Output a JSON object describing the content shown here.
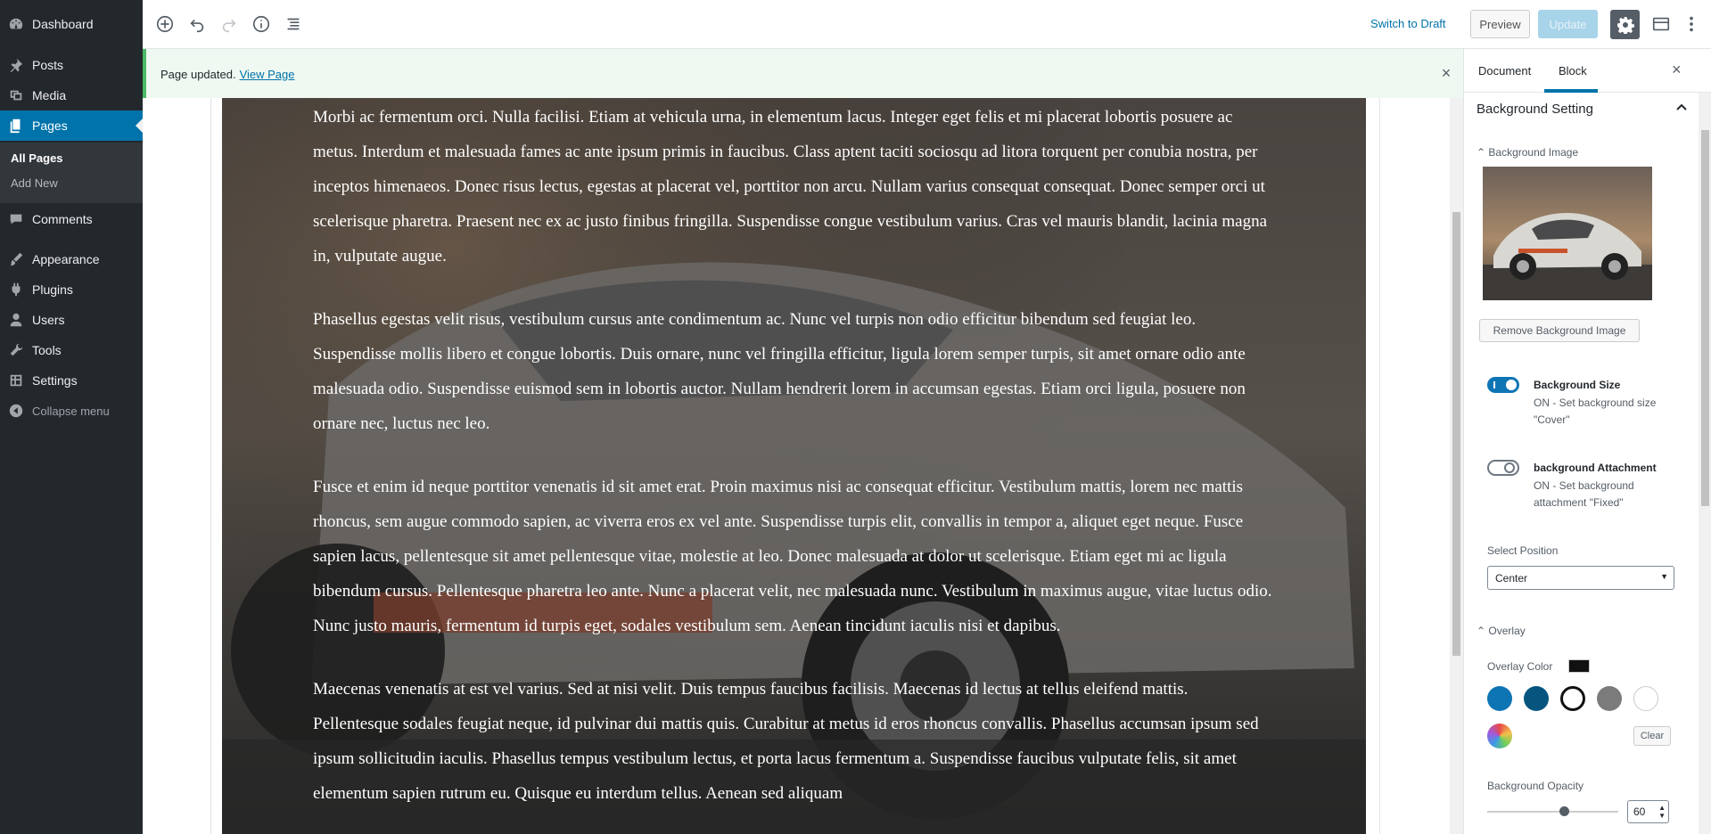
{
  "admin_menu": {
    "items": [
      {
        "label": "Dashboard",
        "icon": "dashboard-icon"
      },
      {
        "label": "Posts",
        "icon": "pin-icon"
      },
      {
        "label": "Media",
        "icon": "media-icon"
      },
      {
        "label": "Pages",
        "icon": "pages-icon"
      },
      {
        "label": "Comments",
        "icon": "comments-icon"
      },
      {
        "label": "Appearance",
        "icon": "brush-icon"
      },
      {
        "label": "Plugins",
        "icon": "plugin-icon"
      },
      {
        "label": "Users",
        "icon": "users-icon"
      },
      {
        "label": "Tools",
        "icon": "wrench-icon"
      },
      {
        "label": "Settings",
        "icon": "settings-icon"
      },
      {
        "label": "Collapse menu",
        "icon": "collapse-icon"
      }
    ],
    "submenu": [
      {
        "label": "All Pages"
      },
      {
        "label": "Add New"
      }
    ]
  },
  "toolbar": {
    "switch_to_draft": "Switch to Draft",
    "preview": "Preview",
    "update": "Update"
  },
  "notice": {
    "message": "Page updated.",
    "link": "View Page"
  },
  "content": {
    "paragraphs": [
      "Morbi ac fermentum orci. Nulla facilisi. Etiam at vehicula urna, in elementum lacus. Integer eget felis et mi placerat lobortis posuere ac metus. Interdum et malesuada fames ac ante ipsum primis in faucibus. Class aptent taciti sociosqu ad litora torquent per conubia nostra, per inceptos himenaeos. Donec risus lectus, egestas at placerat vel, porttitor non arcu. Nullam varius consequat consequat. Donec semper orci ut scelerisque pharetra. Praesent nec ex ac justo finibus fringilla. Suspendisse congue vestibulum varius. Cras vel mauris blandit, lacinia magna in, vulputate augue.",
      "Phasellus egestas velit risus, vestibulum cursus ante condimentum ac. Nunc vel turpis non odio efficitur bibendum sed feugiat leo. Suspendisse mollis libero et congue lobortis. Duis ornare, nunc vel fringilla efficitur, ligula lorem semper turpis, sit amet ornare odio ante malesuada odio. Suspendisse euismod sem in lobortis auctor. Nullam hendrerit lorem in accumsan egestas. Etiam orci ligula, posuere non ornare nec, luctus nec leo.",
      "Fusce et enim id neque porttitor venenatis id sit amet erat. Proin maximus nisi ac consequat efficitur. Vestibulum mattis, lorem nec mattis rhoncus, sem augue commodo sapien, ac viverra eros ex vel ante. Suspendisse turpis elit, convallis in tempor a, aliquet eget neque. Fusce sapien lacus, pellentesque sit amet pellentesque vitae, molestie at leo. Donec malesuada at dolor ut scelerisque. Etiam eget mi ac ligula bibendum cursus. Pellentesque pharetra leo ante. Nunc a placerat velit, nec malesuada nunc. Vestibulum in maximus augue, vitae luctus odio. Nunc justo mauris, fermentum id turpis eget, sodales vestibulum sem. Aenean tincidunt iaculis nisi et dapibus.",
      "Maecenas venenatis at est vel varius. Sed at nisi velit. Duis tempus faucibus facilisis. Maecenas id lectus at tellus eleifend mattis. Pellentesque sodales feugiat neque, id pulvinar dui mattis quis. Curabitur at metus id eros rhoncus convallis. Phasellus accumsan ipsum sed ipsum sollicitudin iaculis. Phasellus tempus vestibulum lectus, et porta lacus fermentum a. Suspendisse faucibus vulputate felis, sit amet elementum sapien rutrum eu. Quisque eu interdum tellus. Aenean sed aliquam"
    ]
  },
  "sidebar": {
    "tabs": [
      {
        "label": "Document"
      },
      {
        "label": "Block"
      }
    ],
    "active_tab": "Block",
    "panel_title": "Background Setting",
    "background_image": {
      "title": "Background Image",
      "remove_label": "Remove Background Image"
    },
    "background_size": {
      "label": "Background Size",
      "description": "ON - Set background size \"Cover\"",
      "enabled": true
    },
    "background_attachment": {
      "label": "background Attachment",
      "description": "ON - Set background attachment \"Fixed\"",
      "enabled": false
    },
    "position": {
      "label": "Select Position",
      "value": "Center"
    },
    "overlay": {
      "title": "Overlay",
      "color_label": "Overlay Color",
      "selected_color": "#111111",
      "palette": [
        "#0e75b5",
        "#05557f",
        "#ffffff",
        "#7b7b7b",
        "#ffffff"
      ],
      "clear_label": "Clear"
    },
    "opacity": {
      "label": "Background Opacity",
      "value": "60",
      "fraction": 0.6
    }
  },
  "colors": {
    "admin_bg": "#23282d",
    "accent": "#0073aa",
    "notice_border": "#4ab866"
  }
}
